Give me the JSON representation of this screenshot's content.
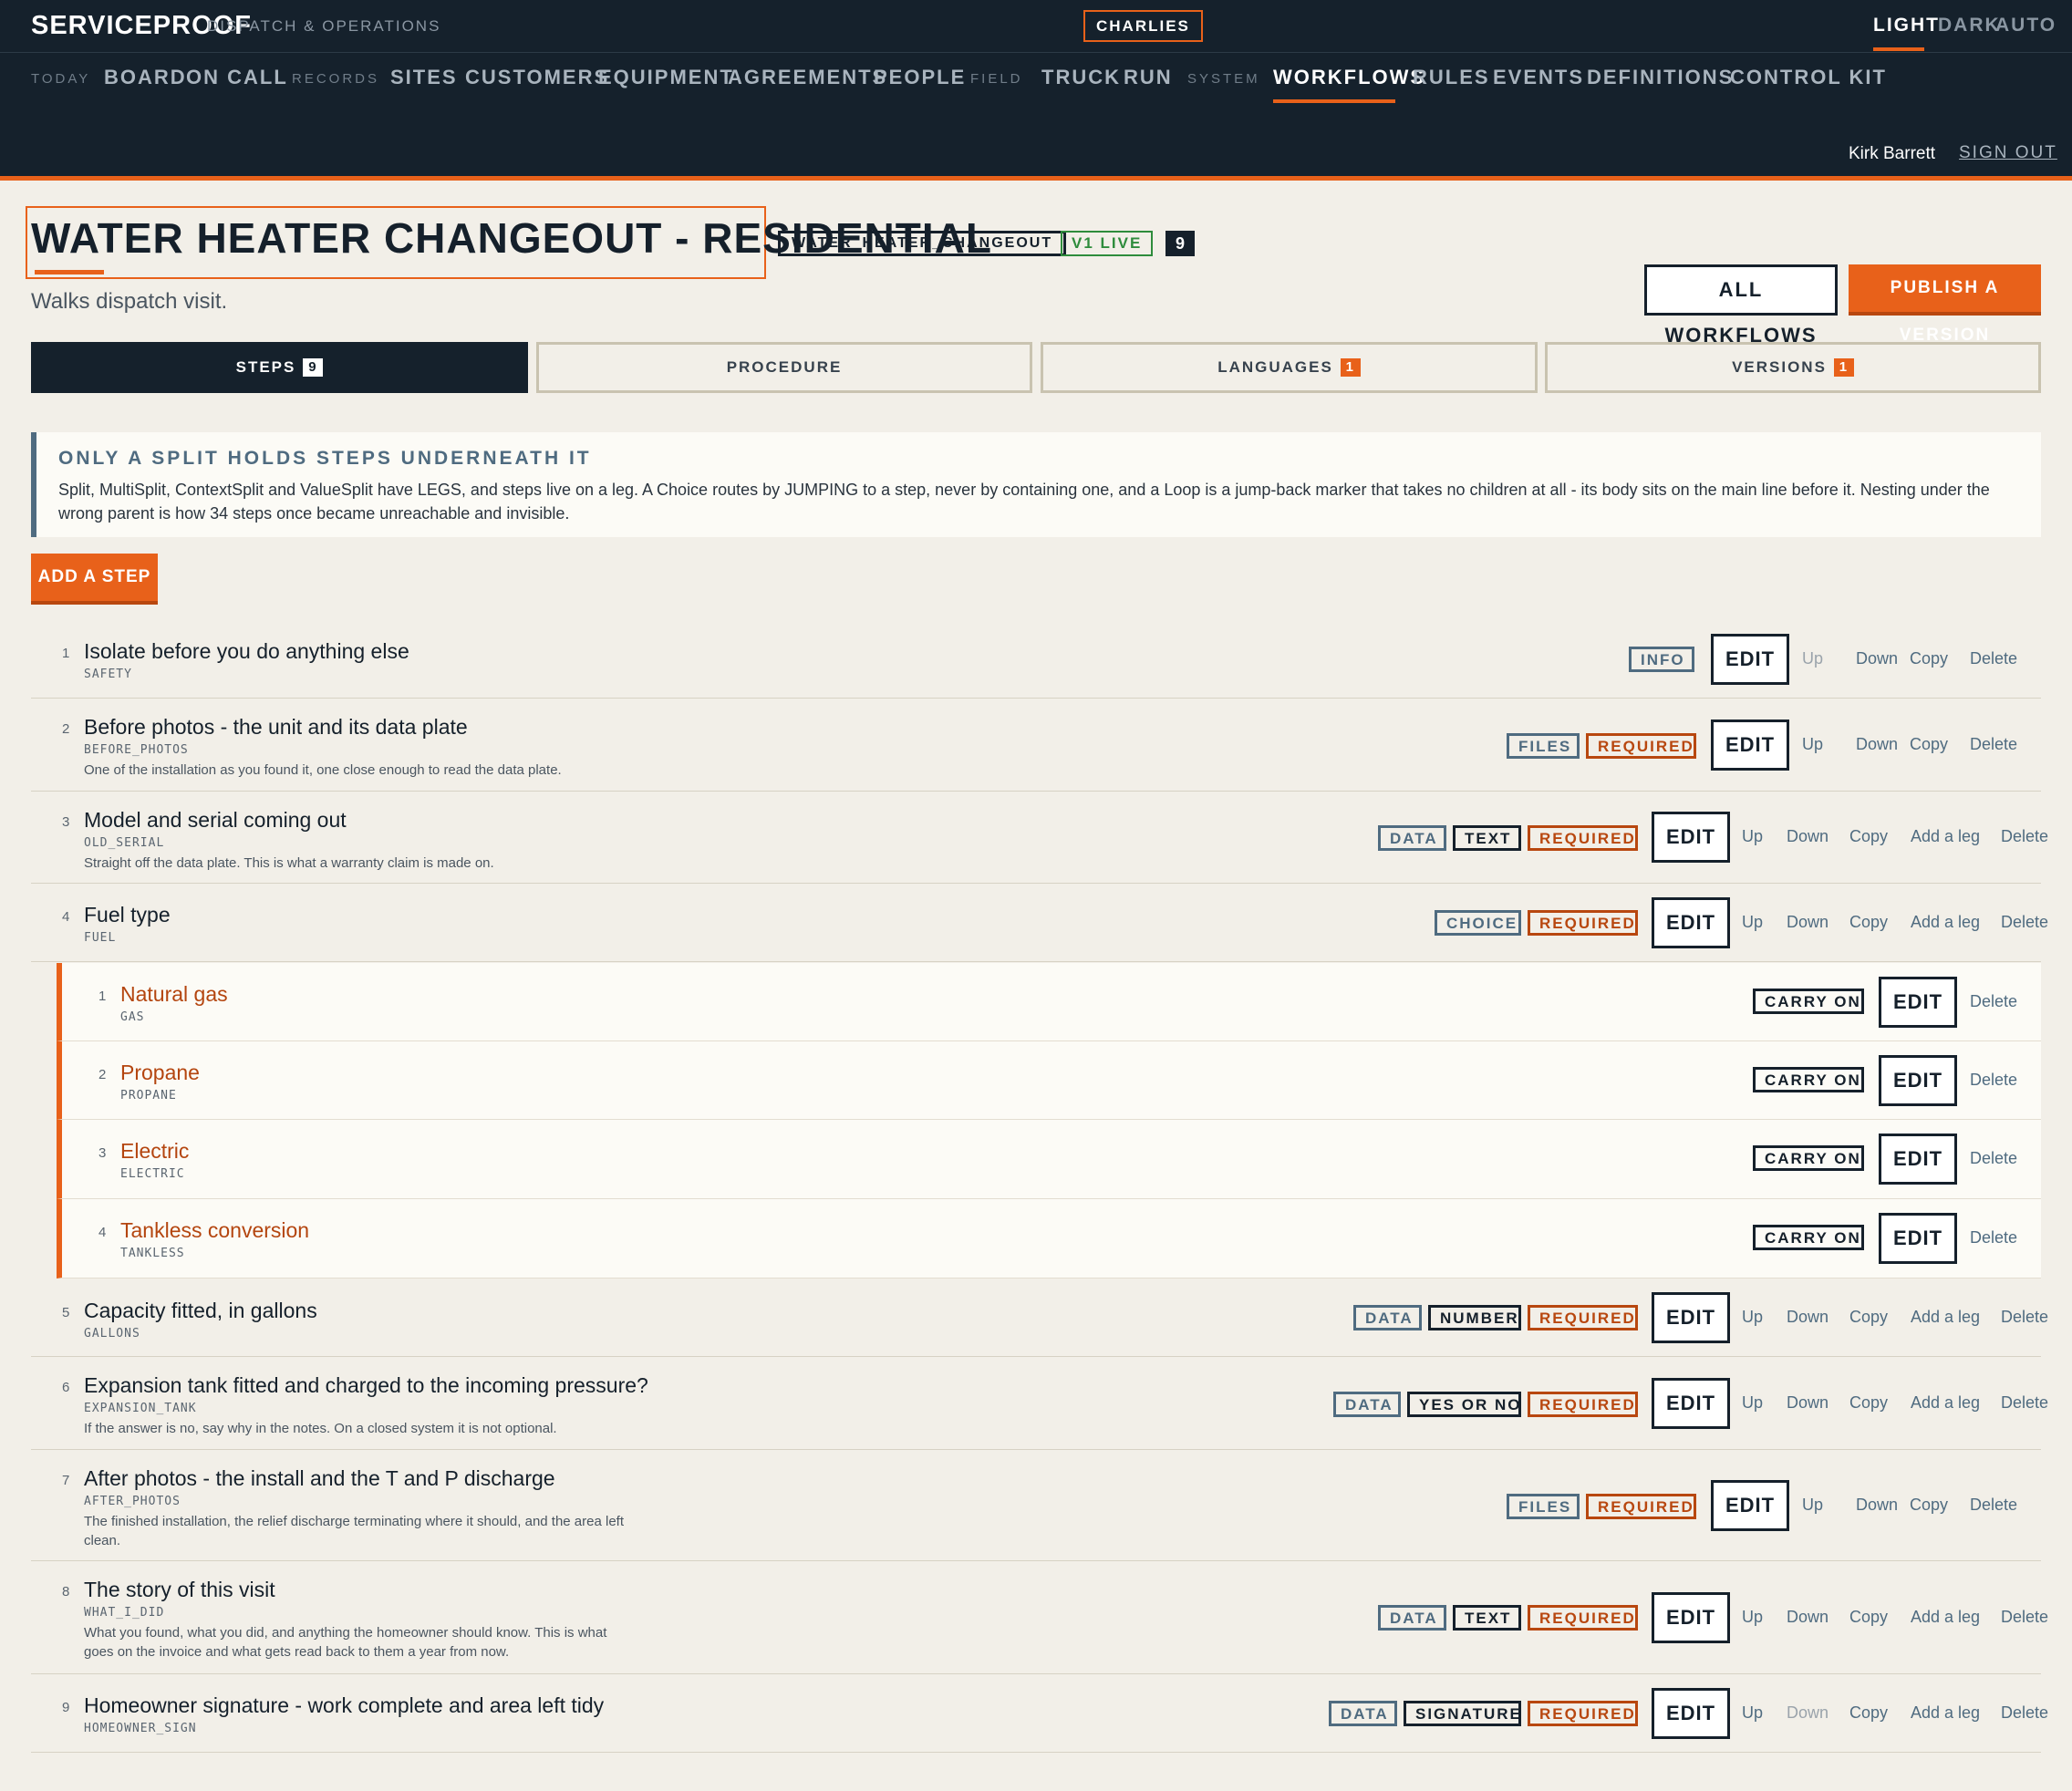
{
  "header": {
    "brand": "SERVICEPROOF",
    "brand_sub": "DISPATCH & OPERATIONS",
    "tenant": "CHARLIES",
    "modes": [
      "LIGHT",
      "DARK",
      "AUTO"
    ],
    "active_mode": "LIGHT",
    "nav_groups": {
      "today": "TODAY",
      "records": "RECORDS",
      "field": "FIELD",
      "system": "SYSTEM"
    },
    "nav": {
      "board": "BOARD",
      "on_call": "ON CALL",
      "sites": "SITES",
      "customers": "CUSTOMERS",
      "equipment": "EQUIPMENT",
      "agreements": "AGREEMENTS",
      "people": "PEOPLE",
      "truck": "TRUCK",
      "run": "RUN",
      "workflows": "WORKFLOWS",
      "rules": "RULES",
      "events": "EVENTS",
      "definitions": "DEFINITIONS",
      "control_kit": "CONTROL KIT"
    },
    "active_nav": "WORKFLOWS",
    "user": "Kirk Barrett",
    "sign_out": "SIGN OUT"
  },
  "workflow": {
    "title": "WATER HEATER CHANGEOUT - RESIDENTIAL",
    "key": "WATER_HEATER_CHANGEOUT",
    "status": "V1 LIVE",
    "step_count": "9",
    "subtitle": "Walks dispatch visit.",
    "all_workflows_label": "ALL WORKFLOWS",
    "publish_label": "PUBLISH A VERSION"
  },
  "tabs": [
    {
      "label": "STEPS",
      "badge": "9"
    },
    {
      "label": "PROCEDURE",
      "badge": ""
    },
    {
      "label": "LANGUAGES",
      "badge": "1"
    },
    {
      "label": "VERSIONS",
      "badge": "1"
    }
  ],
  "callout": {
    "title": "ONLY A SPLIT HOLDS STEPS UNDERNEATH IT",
    "body": "Split, MultiSplit, ContextSplit and ValueSplit have LEGS, and steps live on a leg. A Choice routes by JUMPING to a step, never by containing one, and a Loop is a jump-back marker that takes no children at all - its body sits on the main line before it. Nesting under the wrong parent is how 34 steps once became unreachable and invisible."
  },
  "add_step_label": "ADD A STEP",
  "labels": {
    "edit": "EDIT",
    "up": "Up",
    "down": "Down",
    "copy": "Copy",
    "add_leg": "Add a leg",
    "delete": "Delete",
    "carry_on": "CARRY ON",
    "required": "REQUIRED"
  },
  "steps": [
    {
      "num": "1",
      "title": "Isolate before you do anything else",
      "key": "SAFETY",
      "desc": "",
      "kind": "INFO",
      "dtype": "",
      "required": false
    },
    {
      "num": "2",
      "title": "Before photos - the unit and its data plate",
      "key": "BEFORE_PHOTOS",
      "desc": "One of the installation as you found it, one close enough to read the data plate.",
      "kind": "FILES",
      "dtype": "",
      "required": true
    },
    {
      "num": "3",
      "title": "Model and serial coming out",
      "key": "OLD_SERIAL",
      "desc": "Straight off the data plate. This is what a warranty claim is made on.",
      "kind": "DATA",
      "dtype": "TEXT",
      "required": true
    },
    {
      "num": "4",
      "title": "Fuel type",
      "key": "FUEL",
      "desc": "",
      "kind": "CHOICE",
      "dtype": "",
      "required": true
    },
    {
      "num": "5",
      "title": "Capacity fitted, in gallons",
      "key": "GALLONS",
      "desc": "",
      "kind": "DATA",
      "dtype": "NUMBER",
      "required": true
    },
    {
      "num": "6",
      "title": "Expansion tank fitted and charged to the incoming pressure?",
      "key": "EXPANSION_TANK",
      "desc": "If the answer is no, say why in the notes. On a closed system it is not optional.",
      "kind": "DATA",
      "dtype": "YES OR NO",
      "required": true
    },
    {
      "num": "7",
      "title": "After photos - the install and the T and P discharge",
      "key": "AFTER_PHOTOS",
      "desc": "The finished installation, the relief discharge terminating where it should, and the area left clean.",
      "kind": "FILES",
      "dtype": "",
      "required": true
    },
    {
      "num": "8",
      "title": "The story of this visit",
      "key": "WHAT_I_DID",
      "desc": "What you found, what you did, and anything the homeowner should know. This is what goes on the invoice and what gets read back to them a year from now.",
      "kind": "DATA",
      "dtype": "TEXT",
      "required": true
    },
    {
      "num": "9",
      "title": "Homeowner signature - work complete and area left tidy",
      "key": "HOMEOWNER_SIGN",
      "desc": "",
      "kind": "DATA",
      "dtype": "SIGNATURE",
      "required": true
    }
  ],
  "fuel_options": [
    {
      "num": "1",
      "title": "Natural gas",
      "key": "GAS"
    },
    {
      "num": "2",
      "title": "Propane",
      "key": "PROPANE"
    },
    {
      "num": "3",
      "title": "Electric",
      "key": "ELECTRIC"
    },
    {
      "num": "4",
      "title": "Tankless conversion",
      "key": "TANKLESS"
    }
  ],
  "colors": {
    "accent": "#e8611a",
    "header_bg": "#15212c",
    "page_bg": "#f2efe8",
    "live_green": "#2e8c3c",
    "kind_slate": "#4f6b80",
    "required_rust": "#b8470f"
  }
}
